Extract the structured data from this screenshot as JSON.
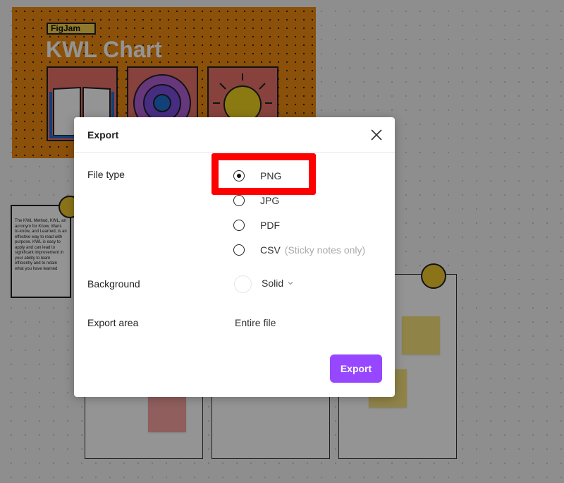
{
  "background_board": {
    "hero_tag": "FigJam",
    "hero_title": "KWL Chart",
    "note_text": "The KWL Method, KWL, an acronym for Know, Want-to-know, and Learned, is an effective way to read with purpose. KWL is easy to apply and can lead to significant improvement in your ability to learn efficiently and to retain what you have learned"
  },
  "dialog": {
    "title": "Export",
    "close_icon": "close-icon",
    "file_type": {
      "label": "File type",
      "options": [
        {
          "label": "PNG",
          "hint": "",
          "selected": true
        },
        {
          "label": "JPG",
          "hint": "",
          "selected": false
        },
        {
          "label": "PDF",
          "hint": "",
          "selected": false
        },
        {
          "label": "CSV",
          "hint": "(Sticky notes only)",
          "selected": false
        }
      ]
    },
    "background": {
      "label": "Background",
      "value": "Solid"
    },
    "export_area": {
      "label": "Export area",
      "value": "Entire file"
    },
    "export_button": "Export"
  },
  "colors": {
    "accent": "#9747ff",
    "highlight": "#ff0000",
    "hero_orange": "#f08a10",
    "sticky_yellow": "#f7e27a",
    "sticky_pink": "#f7a3a0"
  }
}
